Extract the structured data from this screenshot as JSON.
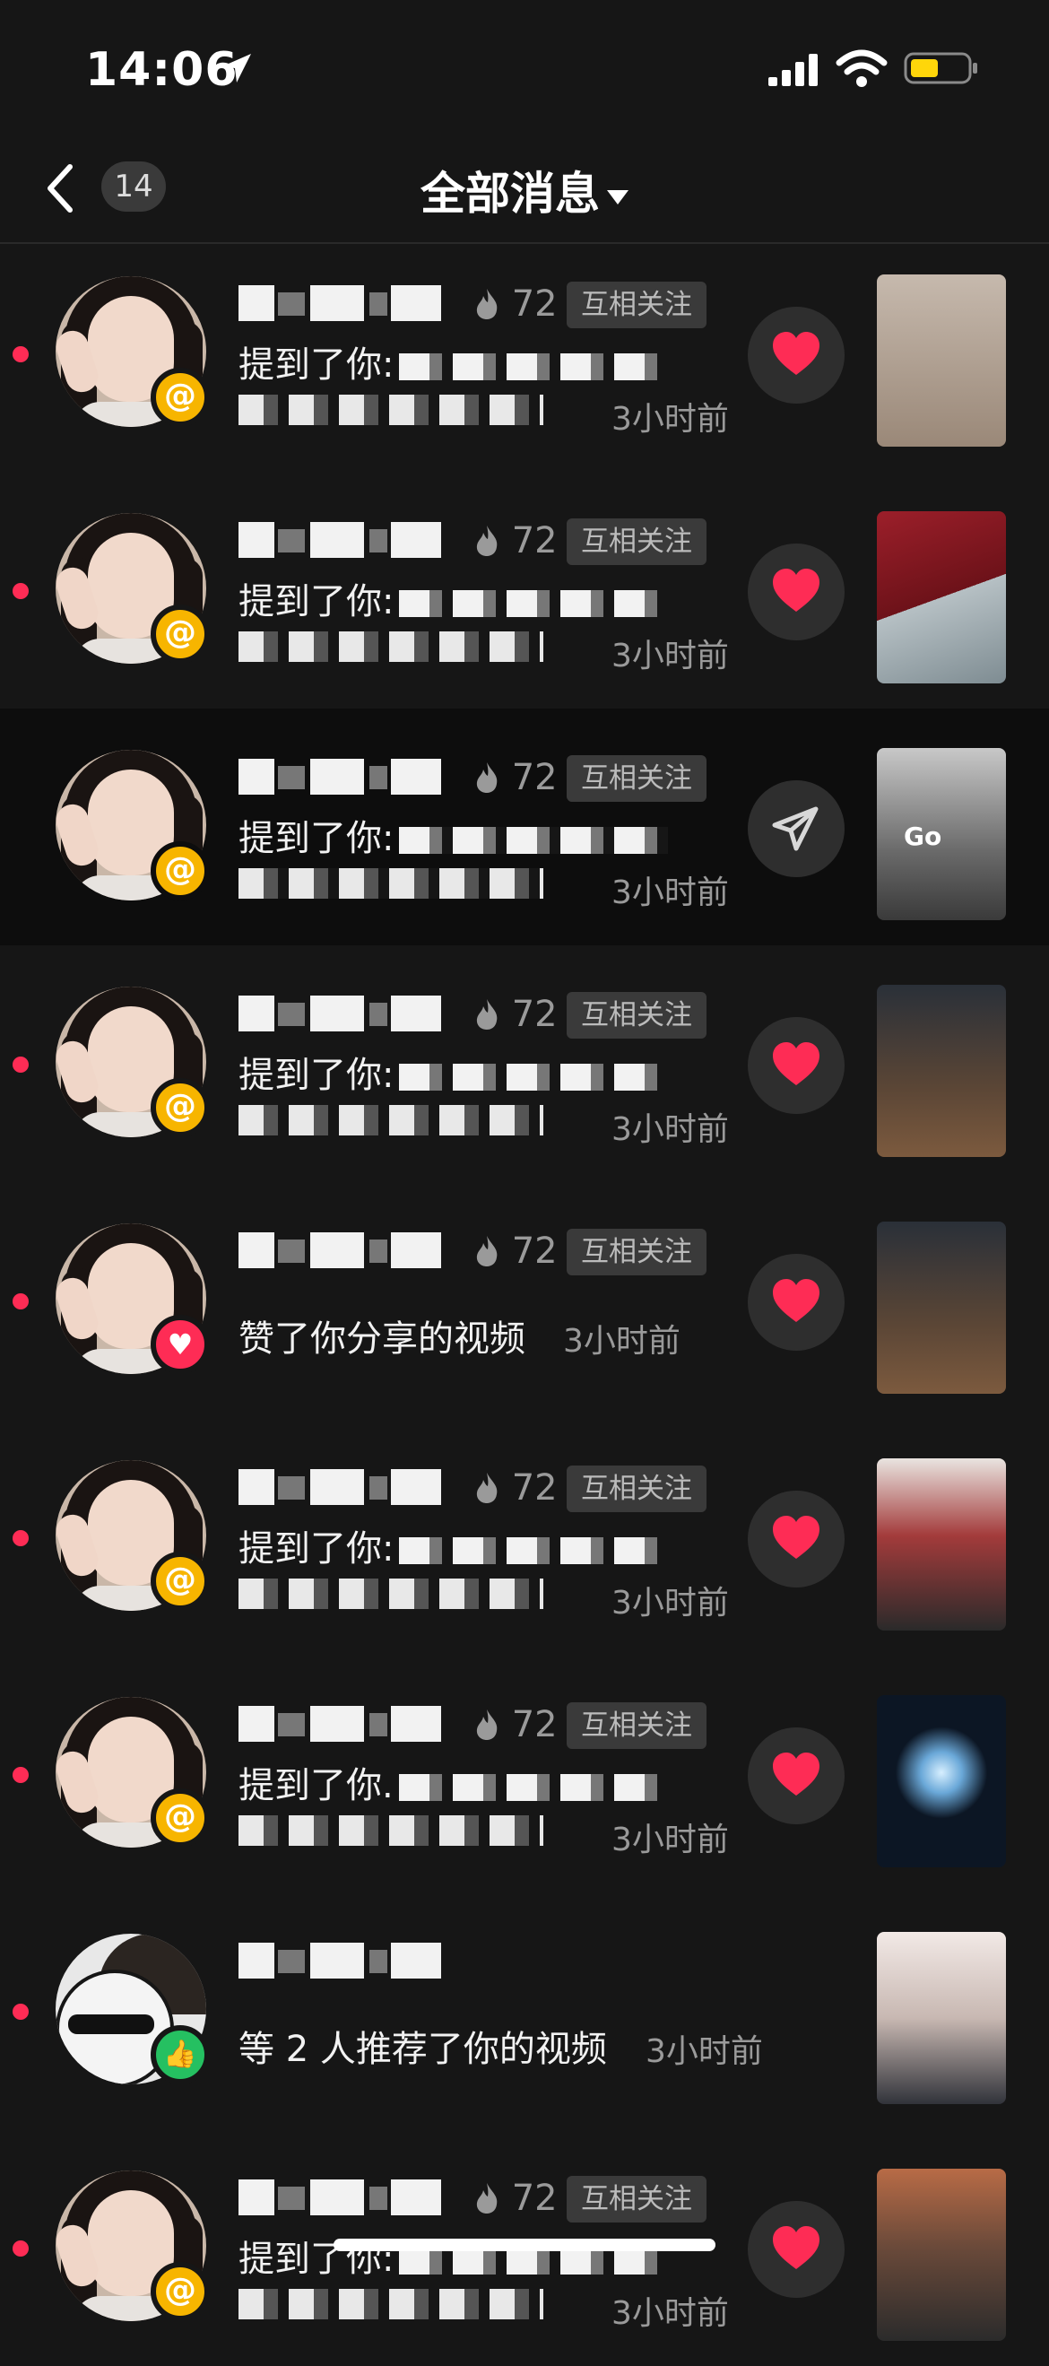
{
  "status_bar": {
    "time": "14:06"
  },
  "nav": {
    "back_count": "14",
    "title": "全部消息"
  },
  "colors": {
    "accent": "#fe2c55",
    "mention_badge": "#f7b500",
    "like_badge": "#25c061"
  },
  "rows": [
    {
      "type": "mention",
      "stats": "72",
      "tag": "互相关注",
      "text": "提到了你:",
      "time": "3小时前",
      "action": "heart-icon",
      "unread": true
    },
    {
      "type": "mention",
      "stats": "72",
      "tag": "互相关注",
      "text": "提到了你:",
      "time": "3小时前",
      "action": "heart-icon",
      "unread": true
    },
    {
      "type": "mention",
      "stats": "72",
      "tag": "互相关注",
      "text": "提到了你:",
      "time": "3小时前",
      "action": "send-icon",
      "unread": false
    },
    {
      "type": "mention",
      "stats": "72",
      "tag": "互相关注",
      "text": "提到了你:",
      "time": "3小时前",
      "action": "heart-icon",
      "unread": true
    },
    {
      "type": "like",
      "stats": "72",
      "tag": "互相关注",
      "text": "赞了你分享的视频",
      "time": "3小时前",
      "action": "heart-icon",
      "unread": true
    },
    {
      "type": "mention",
      "stats": "72",
      "tag": "互相关注",
      "text": "提到了你:",
      "time": "3小时前",
      "action": "heart-icon",
      "unread": true
    },
    {
      "type": "mention",
      "stats": "72",
      "tag": "互相关注",
      "text": "提到了你.",
      "time": "3小时前",
      "action": "heart-icon",
      "unread": true
    },
    {
      "type": "recommend",
      "text": "等 2 人推荐了你的视频",
      "time": "3小时前",
      "unread": true
    },
    {
      "type": "mention",
      "stats": "72",
      "tag": "互相关注",
      "text": "提到了你:",
      "time": "3小时前",
      "action": "heart-icon",
      "unread": true
    }
  ],
  "thumb_texts": {
    "row3": "Go"
  }
}
